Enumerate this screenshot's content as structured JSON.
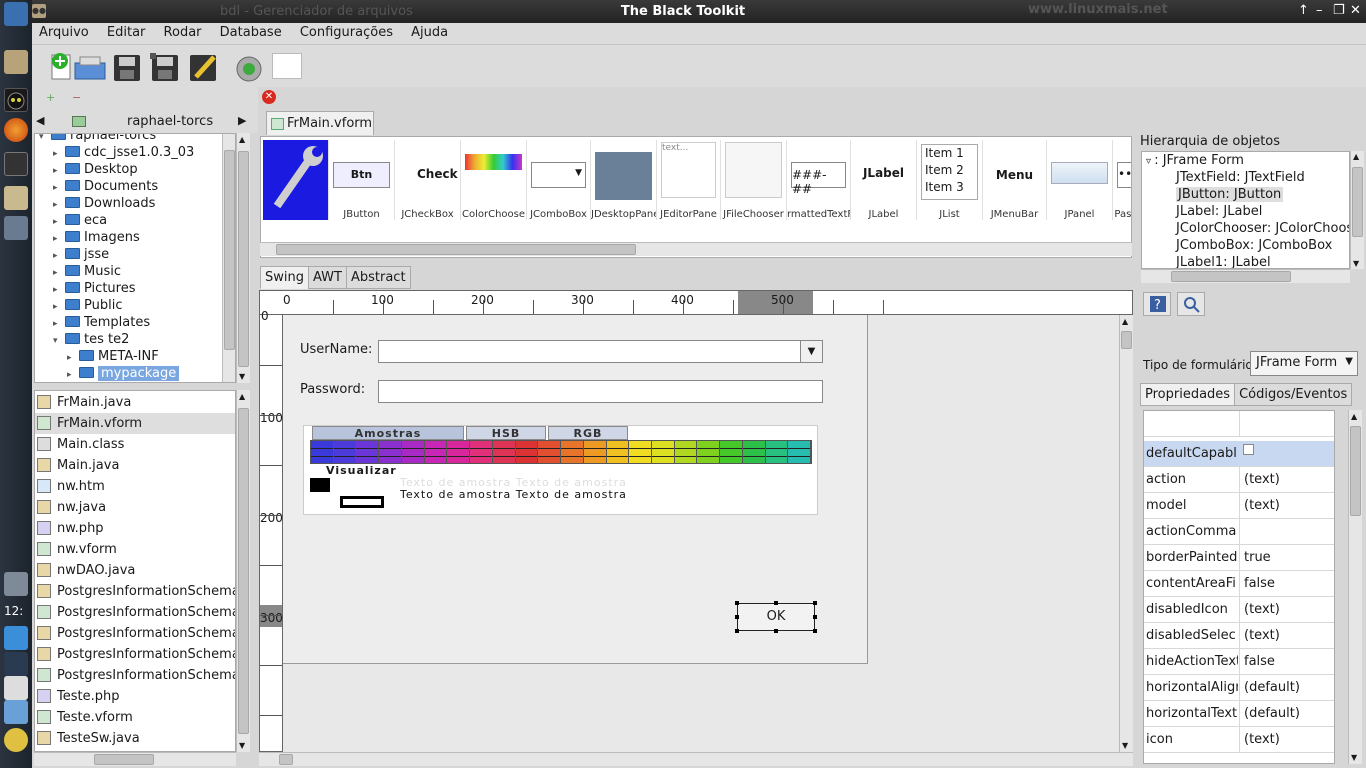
{
  "window": {
    "title": "The Black Toolkit",
    "ghost_title": "bdl - Gerenciador de arquivos",
    "watermark": "www.linuxmais.net",
    "controls": [
      "↑",
      "–",
      "❐",
      "✕"
    ]
  },
  "menu": [
    "Arquivo",
    "Editar",
    "Rodar",
    "Database",
    "Configurações",
    "Ajuda"
  ],
  "dock": {
    "clock": "12:"
  },
  "project": {
    "name": "raphael-torcs",
    "root": "raphael-torcs",
    "tree": [
      {
        "label": "cdc_jsse1.0.3_03",
        "level": 1,
        "expanded": false
      },
      {
        "label": "Desktop",
        "level": 1,
        "expanded": false
      },
      {
        "label": "Documents",
        "level": 1,
        "expanded": false
      },
      {
        "label": "Downloads",
        "level": 1,
        "expanded": false
      },
      {
        "label": "eca",
        "level": 1,
        "expanded": false
      },
      {
        "label": "Imagens",
        "level": 1,
        "expanded": false
      },
      {
        "label": "jsse",
        "level": 1,
        "expanded": false
      },
      {
        "label": "Music",
        "level": 1,
        "expanded": false
      },
      {
        "label": "Pictures",
        "level": 1,
        "expanded": false
      },
      {
        "label": "Public",
        "level": 1,
        "expanded": false
      },
      {
        "label": "Templates",
        "level": 1,
        "expanded": false
      },
      {
        "label": "tes te2",
        "level": 1,
        "expanded": true
      },
      {
        "label": "META-INF",
        "level": 2,
        "expanded": false
      },
      {
        "label": "mypackage",
        "level": 2,
        "expanded": false,
        "selected": true
      }
    ]
  },
  "files": [
    {
      "name": "FrMain.java",
      "kind": "java"
    },
    {
      "name": "FrMain.vform",
      "kind": "vform",
      "selected": true
    },
    {
      "name": "Main.class",
      "kind": "class"
    },
    {
      "name": "Main.java",
      "kind": "java"
    },
    {
      "name": "nw.htm",
      "kind": "htm"
    },
    {
      "name": "nw.java",
      "kind": "java"
    },
    {
      "name": "nw.php",
      "kind": "php"
    },
    {
      "name": "nw.vform",
      "kind": "vform"
    },
    {
      "name": "nwDAO.java",
      "kind": "java"
    },
    {
      "name": "PostgresInformationSchema",
      "kind": "java"
    },
    {
      "name": "PostgresInformationSchema",
      "kind": "vform"
    },
    {
      "name": "PostgresInformationSchema",
      "kind": "java"
    },
    {
      "name": "PostgresInformationSchema",
      "kind": "java"
    },
    {
      "name": "PostgresInformationSchema",
      "kind": "vform"
    },
    {
      "name": "Teste.php",
      "kind": "php"
    },
    {
      "name": "Teste.vform",
      "kind": "vform"
    },
    {
      "name": "TesteSw.java",
      "kind": "java"
    }
  ],
  "editor_tab": "FrMain.vform",
  "palette": [
    {
      "label": "",
      "preview": ""
    },
    {
      "label": "JButton",
      "preview": "Btn"
    },
    {
      "label": "JCheckBox",
      "preview": "Check"
    },
    {
      "label": "ColorChoose",
      "preview": ""
    },
    {
      "label": "JComboBox",
      "preview": ""
    },
    {
      "label": "JDesktopPane",
      "preview": ""
    },
    {
      "label": "JEditorPane",
      "preview": "text..."
    },
    {
      "label": "JFileChooser",
      "preview": ""
    },
    {
      "label": "rmattedTextFi",
      "preview": "###-##"
    },
    {
      "label": "JLabel",
      "preview": "JLabel"
    },
    {
      "label": "JList",
      "preview": "Item 1\nItem 2\nItem 3"
    },
    {
      "label": "JMenuBar",
      "preview": "Menu"
    },
    {
      "label": "JPanel",
      "preview": ""
    },
    {
      "label": "Pass",
      "preview": "••"
    }
  ],
  "lib_tabs": [
    "Swing",
    "AWT",
    "Abstract"
  ],
  "ruler": {
    "top": [
      "0",
      "100",
      "200",
      "300",
      "400",
      "500"
    ],
    "left": [
      "0",
      "100",
      "200",
      "300"
    ],
    "highlight_top": "500",
    "highlight_left": "300"
  },
  "form": {
    "username_label": "UserName:",
    "password_label": "Password:",
    "ok_label": "OK",
    "cc_tabs": [
      "Amostras",
      "HSB",
      "RGB"
    ],
    "cc_preview_label": "Visualizar",
    "cc_sample_text": "Texto de amostra  Texto de amostra",
    "swatch_colors": [
      "#3a3adb",
      "#4d3adb",
      "#6a36d8",
      "#8a30cf",
      "#a82ac5",
      "#c826b5",
      "#d8279a",
      "#e0307a",
      "#dd3355",
      "#db3333",
      "#e05030",
      "#e6742a",
      "#ec9a24",
      "#f0c020",
      "#f0dc20",
      "#dce020",
      "#b0d820",
      "#80d020",
      "#44c82a",
      "#2cc04a",
      "#28c080",
      "#26bcb0"
    ]
  },
  "hierarchy": {
    "title": "Hierarquia de objetos",
    "items": [
      {
        "label": ": JFrame Form",
        "level": 0
      },
      {
        "label": "JTextField: JTextField",
        "level": 1
      },
      {
        "label": "JButton: JButton",
        "level": 1,
        "selected": true
      },
      {
        "label": "JLabel: JLabel",
        "level": 1
      },
      {
        "label": "JColorChooser: JColorChoos",
        "level": 1
      },
      {
        "label": "JComboBox: JComboBox",
        "level": 1
      },
      {
        "label": "JLabel1: JLabel",
        "level": 1
      }
    ]
  },
  "form_type": {
    "label": "Tipo de formulário",
    "value": "JFrame Form"
  },
  "prop_tabs": [
    "Propriedades",
    "Códigos/Eventos"
  ],
  "properties": [
    {
      "key": "defaultCapabl",
      "value": "",
      "checkbox": true,
      "selected": true
    },
    {
      "key": "action",
      "value": "(text)"
    },
    {
      "key": "model",
      "value": "(text)"
    },
    {
      "key": "actionComma",
      "value": ""
    },
    {
      "key": "borderPainted",
      "value": "true"
    },
    {
      "key": "contentAreaFi",
      "value": "false"
    },
    {
      "key": "disabledIcon",
      "value": "(text)"
    },
    {
      "key": "disabledSelec",
      "value": "(text)"
    },
    {
      "key": "hideActionText",
      "value": "false"
    },
    {
      "key": "horizontalAlign",
      "value": "(default)"
    },
    {
      "key": "horizontalText",
      "value": "(default)"
    },
    {
      "key": "icon",
      "value": "(text)"
    }
  ]
}
